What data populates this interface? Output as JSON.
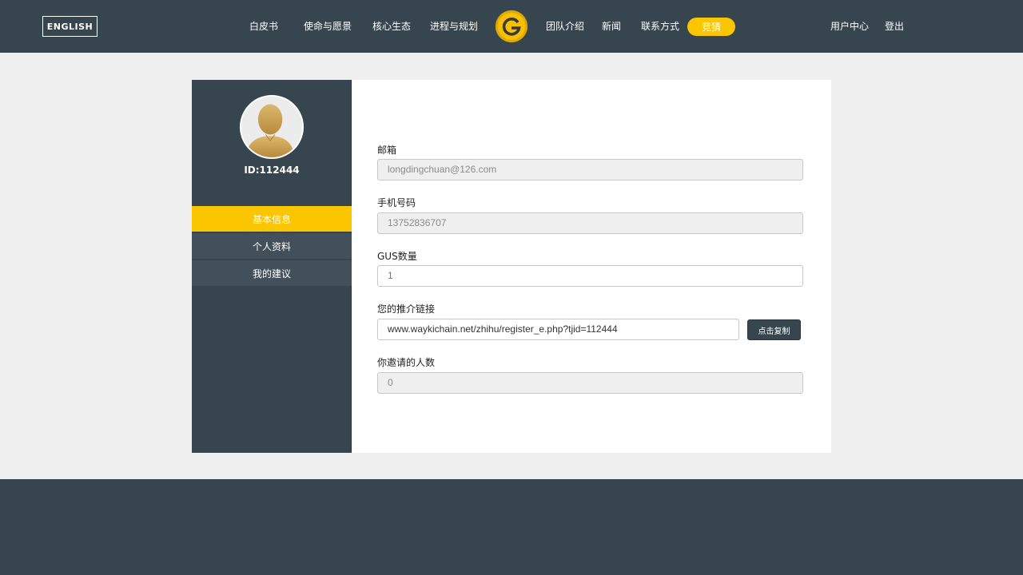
{
  "header": {
    "lang_button": "ENGLISH",
    "nav_left": [
      "白皮书",
      "使命与愿景",
      "核心生态",
      "进程与规划"
    ],
    "nav_right": [
      "团队介绍",
      "新闻",
      "联系方式"
    ],
    "bid_button": "竞猜",
    "user_center": "用户中心",
    "logout": "登出"
  },
  "profile": {
    "id_label": "ID:112444"
  },
  "sidebar": {
    "items": [
      {
        "label": "基本信息",
        "active": true
      },
      {
        "label": "个人资料",
        "active": false
      },
      {
        "label": "我的建议",
        "active": false
      }
    ]
  },
  "form": {
    "email_label": "邮箱",
    "email_value": "longdingchuan@126.com",
    "phone_label": "手机号码",
    "phone_value": "13752836707",
    "gus_label": "GUS数量",
    "gus_value": "1",
    "referral_label": "您的推介链接",
    "referral_value": "www.waykichain.net/zhihu/register_e.php?tjid=112444",
    "copy_button": "点击复制",
    "invited_label": "你邀请的人数",
    "invited_value": "0"
  },
  "colors": {
    "dark": "#37454f",
    "accent": "#fbc500",
    "page_bg": "#efefef"
  }
}
